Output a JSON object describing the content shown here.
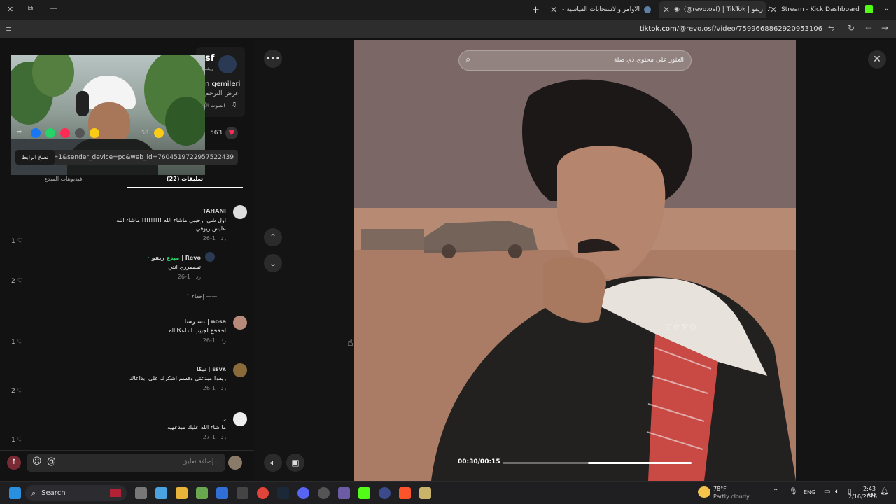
{
  "tabs": [
    {
      "label": "Stream - Kick Dashboard"
    },
    {
      "label": "(@revo.osf) | TikTok | ريفو"
    },
    {
      "label": "الأوامر والاستجابات القياسية - بنظا"
    }
  ],
  "address": {
    "host": "tiktok.com",
    "path": "/@revo.osf/video/7599668862920953106"
  },
  "profile": {
    "name_partial": "sf",
    "sub_partial": "ريف",
    "song_partial": "n gemileri",
    "translate_partial": "عرض الترجم",
    "sound_partial": "الصوت الأ",
    "like_count": "563",
    "save_count_partial": "58"
  },
  "share": {
    "url": "p=1&sender_device=pc&web_id=7604519722957522439...",
    "copy_label": "نسخ الرابط"
  },
  "panel_tabs": {
    "comments": "تعليقات (22)",
    "creator_videos": "فيديوهات المبدع"
  },
  "comments": [
    {
      "name": "TAHANI",
      "text1": "اول شي ارحببي ماشاء الله !!!!!!!!! ماشاء الله",
      "text2": "عليش ريوقي",
      "date": "1-26",
      "reply": "رد",
      "likes": "1"
    },
    {
      "name": "ريفو | Revo",
      "creator": "· مبدع",
      "text1": "تمممرري انتي",
      "text2": "",
      "date": "1-26",
      "reply": "رد",
      "likes": "2"
    },
    {
      "name": "نسـرسا | nosa",
      "text1": "اخخخخ لجبيب ابداعكااااه",
      "text2": "",
      "date": "1-26",
      "reply": "رد",
      "likes": "1"
    },
    {
      "name": "نيكا | ꜱᴇᴠᴀ",
      "text1": "ريفو! مبدعتي وقسم اشكرك على ابداعاك",
      "text2": "",
      "date": "1-26",
      "reply": "رد",
      "likes": "2"
    },
    {
      "name": "ر",
      "text1": "ما شاء الله عليك مبدعهيه",
      "text2": "",
      "date": "1-27",
      "reply": "رد",
      "likes": "1"
    }
  ],
  "hide_replies": "إخفاء",
  "comment_input": {
    "placeholder": "إضافة تعليق..."
  },
  "video": {
    "search_placeholder": "العثور على محتوى ذي صلة",
    "watermark": "revo",
    "time": "00:30/00:15",
    "progress": 0.55
  },
  "taskbar": {
    "search": "Search",
    "weather_temp": "78°F",
    "weather_desc": "Partly cloudy",
    "lang": "ENG",
    "time": "2:43 AM",
    "date": "2/16/2026"
  },
  "colors": {
    "accent": "#fe2c55",
    "kick": "#53fc18"
  }
}
